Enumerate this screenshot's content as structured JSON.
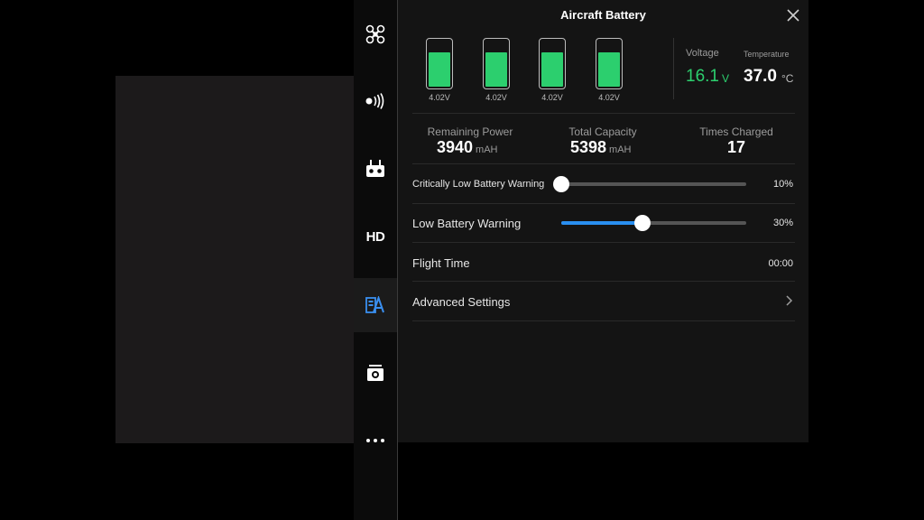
{
  "title": "Aircraft Battery",
  "sidebar": {
    "items": [
      {
        "icon": "aircraft-icon"
      },
      {
        "icon": "remote-signal-icon"
      },
      {
        "icon": "remote-controller-icon"
      },
      {
        "label": "HD"
      },
      {
        "icon": "battery-settings-icon",
        "active": true
      },
      {
        "icon": "camera-icon"
      },
      {
        "icon": "more-icon"
      }
    ]
  },
  "cells": [
    {
      "voltage": "4.02V",
      "level": 0.75
    },
    {
      "voltage": "4.02V",
      "level": 0.75
    },
    {
      "voltage": "4.02V",
      "level": 0.75
    },
    {
      "voltage": "4.02V",
      "level": 0.75
    }
  ],
  "voltage": {
    "label": "Voltage",
    "value": "16.1",
    "unit": "V"
  },
  "temperature": {
    "label": "Temperature",
    "value": "37.0",
    "unit": "°C"
  },
  "info": {
    "remaining": {
      "label": "Remaining Power",
      "value": "3940",
      "unit": "mAH"
    },
    "capacity": {
      "label": "Total Capacity",
      "value": "5398",
      "unit": "mAH"
    },
    "charged": {
      "label": "Times Charged",
      "value": "17"
    }
  },
  "settings": {
    "critical": {
      "label": "Critically Low Battery Warning",
      "value": "10%",
      "percent": 10
    },
    "low": {
      "label": "Low Battery Warning",
      "value": "30%",
      "percent": 30
    },
    "flight_time": {
      "label": "Flight Time",
      "value": "00:00"
    },
    "advanced": {
      "label": "Advanced Settings"
    }
  },
  "colors": {
    "accent_green": "#2ccf6e",
    "accent_blue": "#2a8ff0",
    "active_icon": "#3a8ff0"
  }
}
